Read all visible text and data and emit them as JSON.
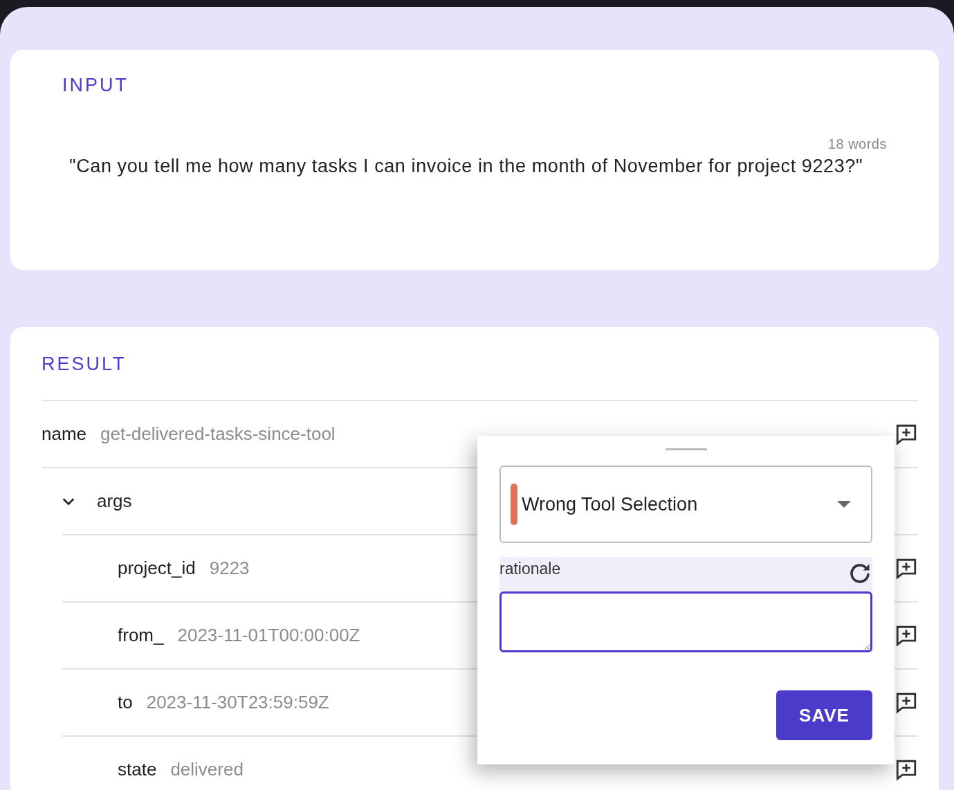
{
  "input": {
    "heading": "INPUT",
    "word_count": "18 words",
    "text": "\"Can you tell me how many tasks I can invoice in the month of November for project 9223?\""
  },
  "result": {
    "heading": "RESULT",
    "fields": [
      {
        "key": "name",
        "value": "get-delivered-tasks-since-tool"
      }
    ],
    "args": {
      "label": "args",
      "expanded": true,
      "children": [
        {
          "key": "project_id",
          "value": "9223"
        },
        {
          "key": "from_",
          "value": "2023-11-01T00:00:00Z"
        },
        {
          "key": "to",
          "value": "2023-11-30T23:59:59Z"
        },
        {
          "key": "state",
          "value": "delivered"
        }
      ]
    }
  },
  "popover": {
    "category": {
      "value": "Wrong Tool Selection",
      "color": "#e0705a"
    },
    "rationale_label": "rationale",
    "save_button": "SAVE"
  }
}
